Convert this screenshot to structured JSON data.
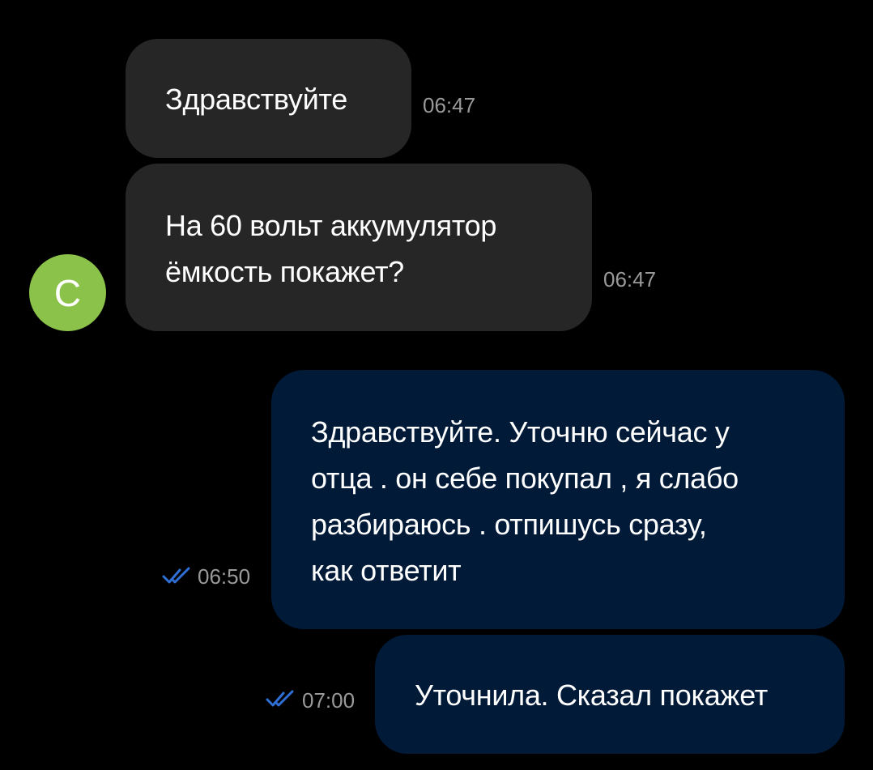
{
  "colors": {
    "background": "#000000",
    "incoming_bubble": "#262626",
    "outgoing_bubble": "#001a38",
    "avatar": "#8bc34a",
    "timestamp": "#9a9a9a",
    "read_check": "#2f6fd6"
  },
  "contact": {
    "avatar_letter": "С"
  },
  "messages": [
    {
      "direction": "incoming",
      "text": "Здравствуйте",
      "time": "06:47"
    },
    {
      "direction": "incoming",
      "text": "На 60 вольт аккумулятор\nёмкость покажет?",
      "time": "06:47"
    },
    {
      "direction": "outgoing",
      "text": "Здравствуйте. Уточню сейчас у\nотца . он себе покупал , я слабо\nразбираюсь . отпишусь сразу,\nкак ответит",
      "time": "06:50",
      "status_icon": "double-check-icon"
    },
    {
      "direction": "outgoing",
      "text": "Уточнила. Сказал покажет",
      "time": "07:00",
      "status_icon": "double-check-icon"
    }
  ]
}
